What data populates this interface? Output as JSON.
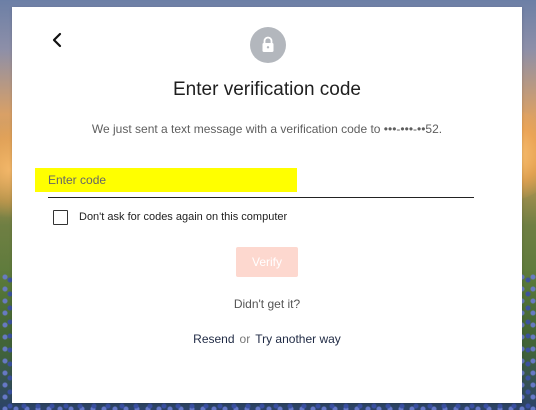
{
  "header": {
    "back_icon": "chevron-left-icon",
    "lock_icon": "lock-icon",
    "title": "Enter verification code",
    "subtitle": "We just sent a text message with a verification code to •••-•••-••52."
  },
  "code_input": {
    "placeholder": "Enter code",
    "value": "",
    "highlight_color": "#ffff00"
  },
  "remember": {
    "label": "Don't ask for codes again on this computer",
    "checked": false
  },
  "verify": {
    "label": "Verify",
    "enabled": false,
    "color": "#fdd8cf"
  },
  "help": {
    "didnt_get": "Didn't get it?",
    "resend": "Resend",
    "or": "or",
    "try_another": "Try another way"
  }
}
